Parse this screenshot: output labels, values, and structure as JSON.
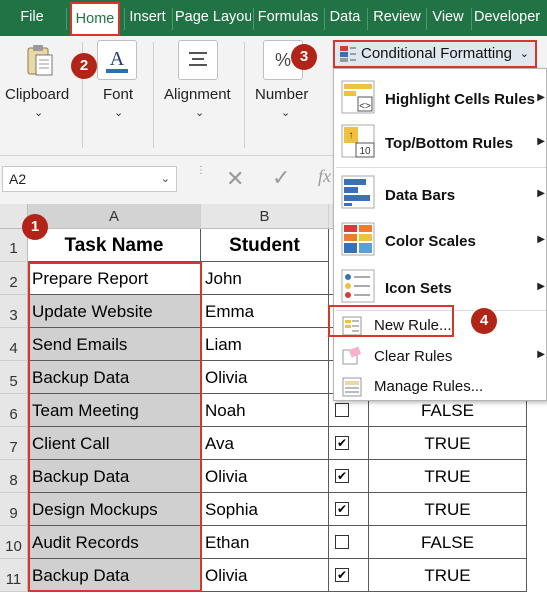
{
  "menubar": {
    "tabs": [
      "File",
      "Home",
      "Insert",
      "Page Layout",
      "Formulas",
      "Data",
      "Review",
      "View",
      "Developer"
    ]
  },
  "ribbon": {
    "clipboard": "Clipboard",
    "font": "Font",
    "alignment": "Alignment",
    "number": "Number",
    "conditional_formatting": "Conditional Formatting"
  },
  "formula_bar": {
    "name_box": "A2",
    "fx": "fx"
  },
  "grid": {
    "columns": [
      "A",
      "B"
    ],
    "rows": [
      "1",
      "2",
      "3",
      "4",
      "5",
      "6",
      "7",
      "8",
      "9",
      "10",
      "11"
    ],
    "headers": [
      "Task Name",
      "Student"
    ],
    "data": [
      {
        "task": "Prepare Report",
        "student": "John",
        "checked": null,
        "status": ""
      },
      {
        "task": "Update Website",
        "student": "Emma",
        "checked": null,
        "status": ""
      },
      {
        "task": "Send Emails",
        "student": "Liam",
        "checked": null,
        "status": ""
      },
      {
        "task": "Backup Data",
        "student": "Olivia",
        "checked": null,
        "status": ""
      },
      {
        "task": "Team Meeting",
        "student": "Noah",
        "checked": false,
        "status": "FALSE"
      },
      {
        "task": "Client Call",
        "student": "Ava",
        "checked": true,
        "status": "TRUE"
      },
      {
        "task": "Backup Data",
        "student": "Olivia",
        "checked": true,
        "status": "TRUE"
      },
      {
        "task": "Design Mockups",
        "student": "Sophia",
        "checked": true,
        "status": "TRUE"
      },
      {
        "task": "Audit Records",
        "student": "Ethan",
        "checked": false,
        "status": "FALSE"
      },
      {
        "task": "Backup Data",
        "student": "Olivia",
        "checked": true,
        "status": "TRUE"
      }
    ]
  },
  "cf_menu": {
    "items": [
      {
        "label": "Highlight Cells Rules",
        "icon": "highlight-cells-icon",
        "submenu": true
      },
      {
        "label": "Top/Bottom Rules",
        "icon": "top-bottom-icon",
        "submenu": true
      },
      {
        "label": "Data Bars",
        "icon": "data-bars-icon",
        "submenu": true
      },
      {
        "label": "Color Scales",
        "icon": "color-scales-icon",
        "submenu": true
      },
      {
        "label": "Icon Sets",
        "icon": "icon-sets-icon",
        "submenu": true
      },
      {
        "label": "New Rule...",
        "icon": "new-rule-icon",
        "submenu": false
      },
      {
        "label": "Clear Rules",
        "icon": "clear-rules-icon",
        "submenu": true
      },
      {
        "label": "Manage Rules...",
        "icon": "manage-rules-icon",
        "submenu": false
      }
    ]
  },
  "badges": [
    "1",
    "2",
    "3",
    "4"
  ],
  "colors": {
    "excel_green": "#217346",
    "highlight_red": "#d9362b",
    "badge_red": "#b12417",
    "selection_gray": "#d0d0d0"
  }
}
